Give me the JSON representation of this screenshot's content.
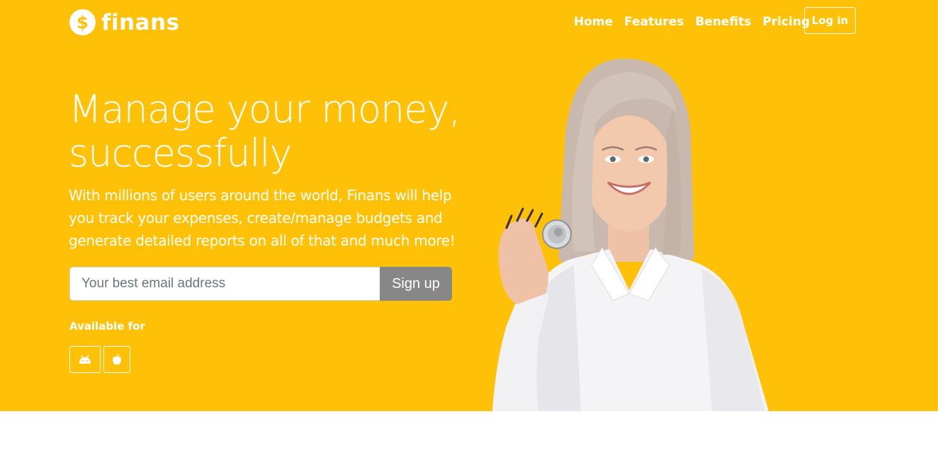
{
  "brand": {
    "logo_symbol": "$",
    "name": "finans"
  },
  "nav": {
    "items": [
      "Home",
      "Features",
      "Benefits",
      "Pricing"
    ]
  },
  "login": {
    "label": "Log in"
  },
  "hero": {
    "headline_line1": "Manage your money,",
    "headline_line2": "successfully",
    "lead": "With millions of users around the world, Finans will help you track your expenses, create/manage budgets and generate detailed reports on all of that and much more!"
  },
  "signup": {
    "placeholder": "Your best email address",
    "button": "Sign up"
  },
  "available": {
    "label": "Available for",
    "platforms": [
      "android-icon",
      "apple-icon"
    ]
  },
  "colors": {
    "accent": "#ffc107",
    "button_gray": "#878787",
    "text_light": "#ffffff"
  }
}
